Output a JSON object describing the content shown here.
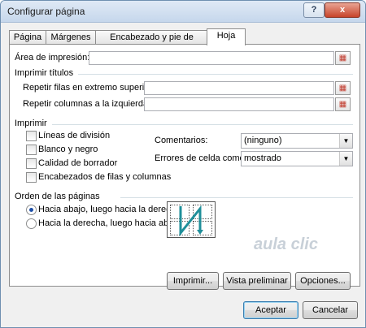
{
  "window": {
    "title": "Configurar página"
  },
  "controls": {
    "help": "?",
    "close": "x"
  },
  "tabs": [
    {
      "label": "Página"
    },
    {
      "label": "Márgenes"
    },
    {
      "label": "Encabezado y pie de página"
    },
    {
      "label": "Hoja"
    }
  ],
  "print_area": {
    "label": "Área de impresión:",
    "value": ""
  },
  "print_titles": {
    "heading": "Imprimir títulos",
    "rows_label": "Repetir filas en extremo superior:",
    "rows_value": "",
    "cols_label": "Repetir columnas a la izquierda:",
    "cols_value": ""
  },
  "print": {
    "heading": "Imprimir",
    "options": [
      {
        "label": "Líneas de división",
        "checked": false
      },
      {
        "label": "Blanco y negro",
        "checked": false
      },
      {
        "label": "Calidad de borrador",
        "checked": false
      },
      {
        "label": "Encabezados de filas y columnas",
        "checked": false
      }
    ],
    "comments_label": "Comentarios:",
    "comments_value": "(ninguno)",
    "errors_label": "Errores de celda como:",
    "errors_value": "mostrado"
  },
  "page_order": {
    "heading": "Orden de las páginas",
    "opt1": "Hacia abajo, luego hacia la derecha",
    "opt2": "Hacia la derecha, luego hacia abajo",
    "selected": "opt1"
  },
  "buttons": {
    "print": "Imprimir...",
    "preview": "Vista preliminar",
    "options": "Opciones...",
    "ok": "Aceptar",
    "cancel": "Cancelar"
  },
  "watermark": "aula clic"
}
